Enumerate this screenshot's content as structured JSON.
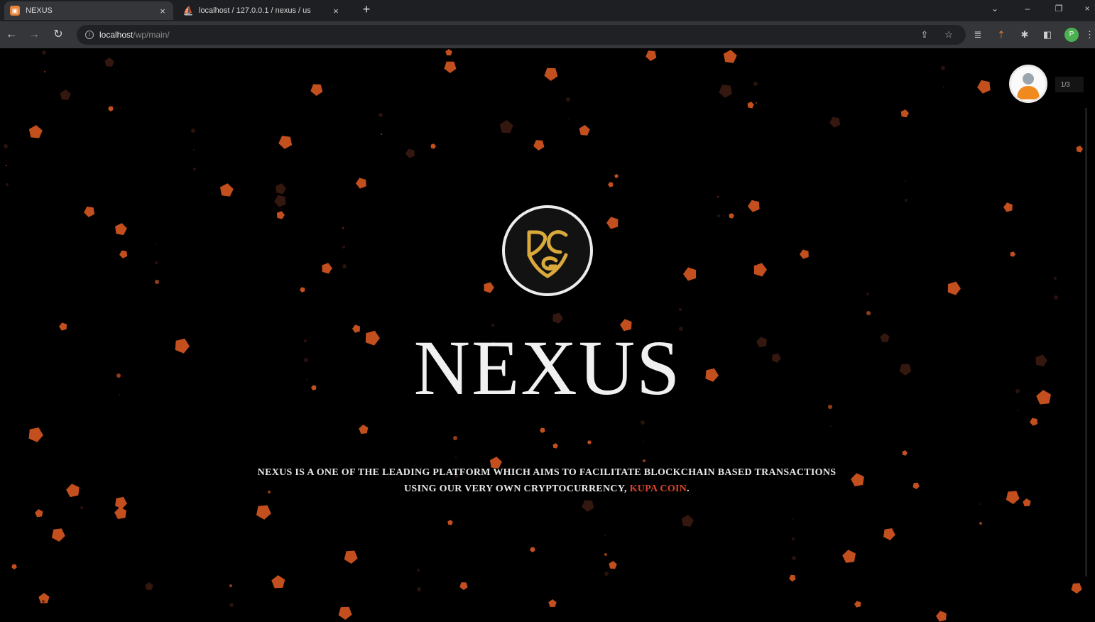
{
  "browser": {
    "tabs": [
      {
        "title": "NEXUS",
        "close_glyph": "×",
        "favicon": "nexus-favicon"
      },
      {
        "title": "localhost / 127.0.0.1 / nexus / us",
        "close_glyph": "×",
        "favicon": "phpmyadmin-favicon"
      }
    ],
    "new_tab_glyph": "+",
    "window_controls": {
      "chevron": "⌄",
      "minimize": "–",
      "restore": "❐",
      "close": "×"
    },
    "nav": {
      "back": "←",
      "forward": "→",
      "reload": "↻"
    },
    "url": {
      "host": "localhost",
      "path": "/wp/main/"
    },
    "toolbar_icons": {
      "share": "⇪",
      "bookmark": "☆",
      "reading_list": "≣",
      "ext_pin": "⇡",
      "extensions": "✱",
      "side_panel": "◧",
      "profile_initial": "P",
      "menu": "⋮"
    }
  },
  "page": {
    "counter_text": "1/3",
    "brand_title": "NEXUS",
    "logo_monogram": "DCG",
    "description_main": "NEXUS IS A ONE OF THE LEADING PLATFORM WHICH AIMS TO FACILITATE BLOCKCHAIN BASED TRANSACTIONS USING OUR VERY OWN CRYPTOCURRENCY,",
    "coin_name": "KUPA COIN",
    "description_end": ".",
    "colors": {
      "background": "#000000",
      "particle": "#d2561f",
      "particle_dim": "#3a1a10",
      "logo_gold": "#d9a93c",
      "accent_red": "#d9452a",
      "title_white": "#f0f0f0"
    }
  }
}
